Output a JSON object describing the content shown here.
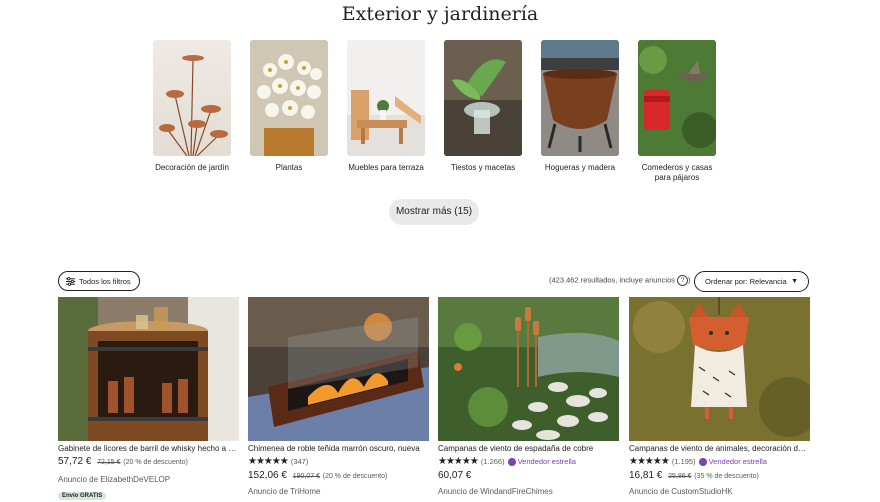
{
  "section": {
    "title": "Exterior y jardinería"
  },
  "categories": [
    {
      "label": "Decoración de jardín"
    },
    {
      "label": "Plantas"
    },
    {
      "label": "Muebles para terraza"
    },
    {
      "label": "Tiestos y macetas"
    },
    {
      "label": "Hogueras y madera"
    },
    {
      "label": "Comederos y casas para pájaros"
    }
  ],
  "show_more": "Mostrar más (15)",
  "filters_button": "Todos los filtros",
  "results_text": "(423.462 resultados, incluye anuncios",
  "results_help": "?",
  "results_close": ")",
  "sort": {
    "label": "Ordenar por: Relevancia",
    "caret": "▼"
  },
  "listings": [
    {
      "title": "Gabinete de licores de barril de whisky hecho a mano",
      "rating": "",
      "reviews": "",
      "star_seller": "",
      "price": "57,72 €",
      "original_price": "72,15 €",
      "discount": "(20 % de descuento)",
      "shop": "Anuncio de ElizabethDeVELOP",
      "badge": "Envío GRATIS"
    },
    {
      "title": "Chimenea de roble teñida marrón oscuro, nueva",
      "rating": "★★★★★",
      "reviews": "(347)",
      "star_seller": "",
      "price": "152,06 €",
      "original_price": "190,07 €",
      "discount": "(20 % de descuento)",
      "shop": "Anuncio de TriHome",
      "badge": ""
    },
    {
      "title": "Campanas de viento de espadaña de cobre",
      "rating": "★★★★★",
      "reviews": "(1.266)",
      "star_seller": "Vendedor estrella",
      "price": "60,07 €",
      "original_price": "",
      "discount": "",
      "shop": "Anuncio de WindandFireChimes",
      "badge": ""
    },
    {
      "title": "Campanas de viento de animales, decoración de jardín",
      "rating": "★★★★★",
      "reviews": "(1.195)",
      "star_seller": "Vendedor estrella",
      "price": "16,81 €",
      "original_price": "25,86 €",
      "discount": "(35 % de descuento)",
      "shop": "Anuncio de CustomStudioHK",
      "badge": ""
    }
  ]
}
